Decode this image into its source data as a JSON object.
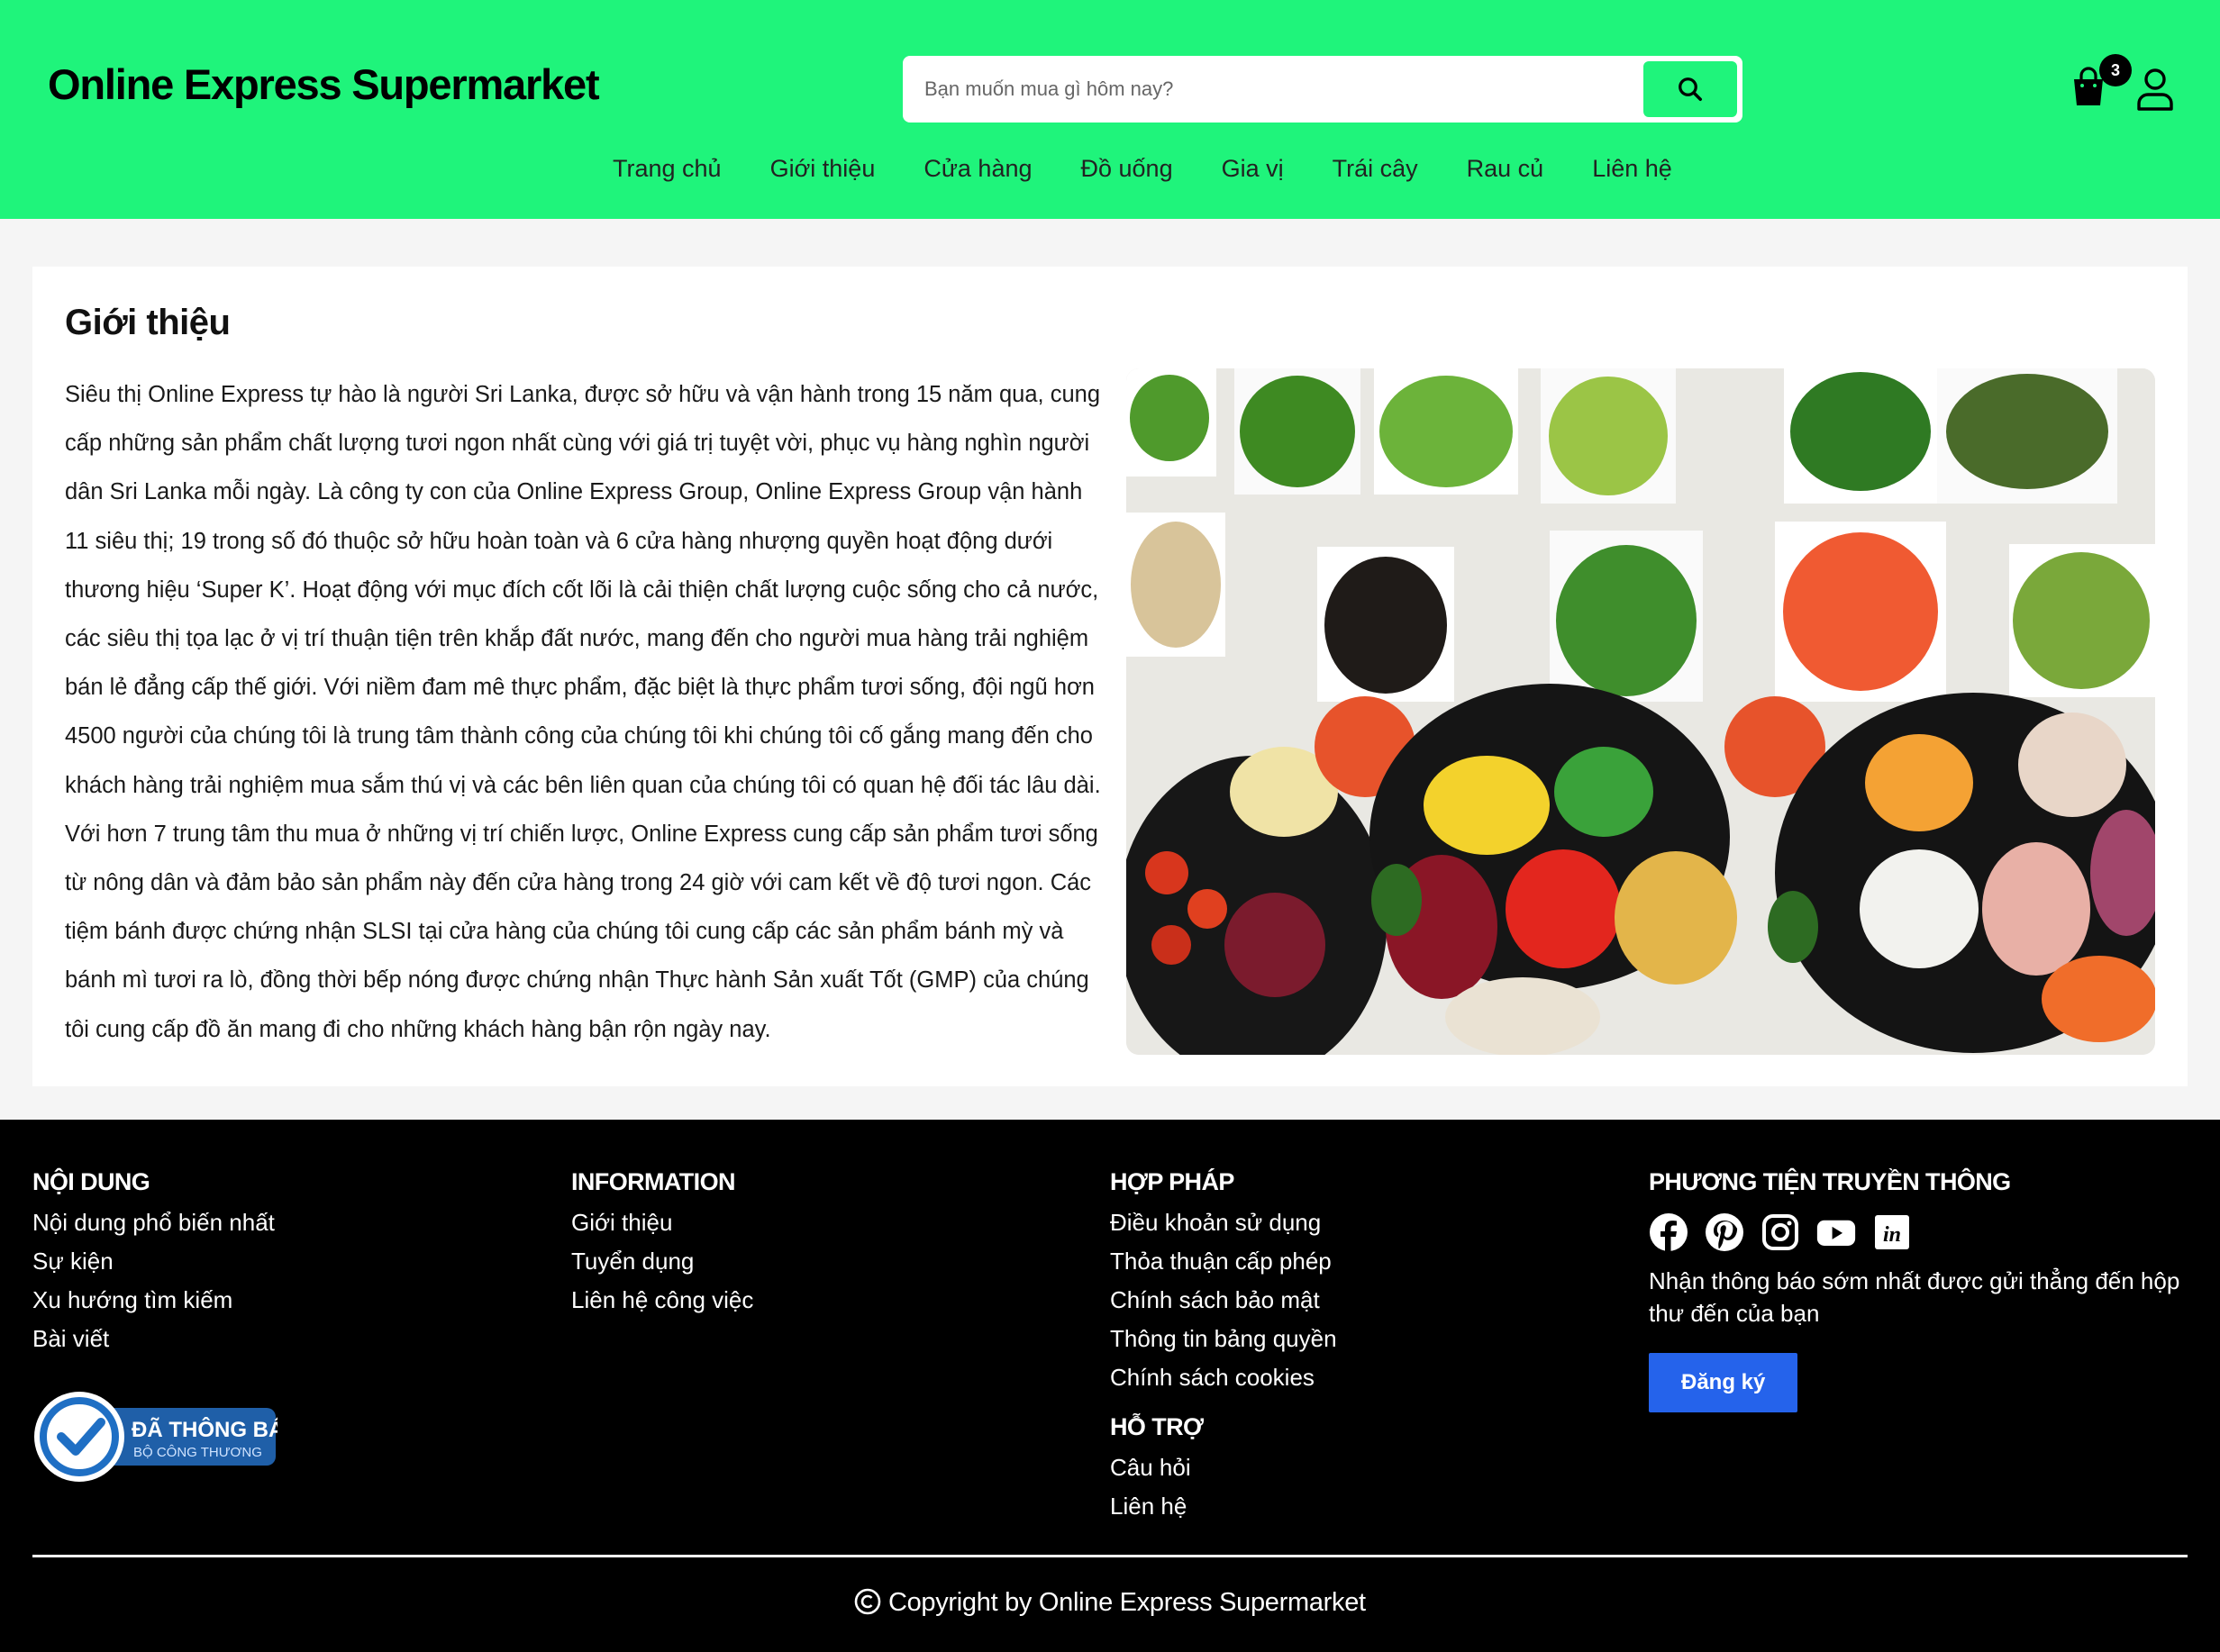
{
  "header": {
    "logo": "Online Express Supermarket",
    "search_placeholder": "Bạn muốn mua gì hôm nay?",
    "cart_count": "3",
    "nav": [
      "Trang chủ",
      "Giới thiệu",
      "Cửa hàng",
      "Đồ uống",
      "Gia vị",
      "Trái cây",
      "Rau củ",
      "Liên hệ"
    ]
  },
  "main": {
    "title": "Giới thiệu",
    "paragraph": "Siêu thị Online Express tự hào là người Sri Lanka, được sở hữu và vận hành trong 15 năm qua, cung cấp những sản phẩm chất lượng tươi ngon nhất cùng với giá trị tuyệt vời, phục vụ hàng nghìn người dân Sri Lanka mỗi ngày. Là công ty con của Online Express Group, Online Express Group vận hành 11 siêu thị; 19 trong số đó thuộc sở hữu hoàn toàn và 6 cửa hàng nhượng quyền hoạt động dưới thương hiệu ‘Super K’. Hoạt động với mục đích cốt lõi là cải thiện chất lượng cuộc sống cho cả nước, các siêu thị tọa lạc ở vị trí thuận tiện trên khắp đất nước, mang đến cho người mua hàng trải nghiệm bán lẻ đẳng cấp thế giới. Với niềm đam mê thực phẩm, đặc biệt là thực phẩm tươi sống, đội ngũ hơn 4500 người của chúng tôi là trung tâm thành công của chúng tôi khi chúng tôi cố gắng mang đến cho khách hàng trải nghiệm mua sắm thú vị và các bên liên quan của chúng tôi có quan hệ đối tác lâu dài. Với hơn 7 trung tâm thu mua ở những vị trí chiến lược, Online Express cung cấp sản phẩm tươi sống từ nông dân và đảm bảo sản phẩm này đến cửa hàng trong 24 giờ với cam kết về độ tươi ngon. Các tiệm bánh được chứng nhận SLSI tại cửa hàng của chúng tôi cung cấp các sản phẩm bánh mỳ và bánh mì tươi ra lò, đồng thời bếp nóng được chứng nhận Thực hành Sản xuất Tốt (GMP) của chúng tôi cung cấp đồ ăn mang đi cho những khách hàng bận rộn ngày nay."
  },
  "footer": {
    "content": {
      "title": "NỘI DUNG",
      "links": [
        "Nội dung phổ biến nhất",
        "Sự kiện",
        "Xu hướng tìm kiếm",
        "Bài viết"
      ]
    },
    "information": {
      "title": "INFORMATION",
      "links": [
        "Giới thiệu",
        "Tuyển dụng",
        "Liên hệ công việc"
      ]
    },
    "legal": {
      "title": "HỢP PHÁP",
      "links": [
        "Điều khoản sử dụng",
        "Thỏa thuận cấp phép",
        "Chính sách bảo mật",
        "Thông tin bảng quyền",
        "Chính sách cookies"
      ]
    },
    "support": {
      "title": "HỖ TRỢ",
      "links": [
        "Câu hỏi",
        "Liên hệ"
      ]
    },
    "media": {
      "title": "PHƯƠNG TIỆN TRUYỀN THÔNG",
      "icons": [
        "facebook-icon",
        "pinterest-icon",
        "instagram-icon",
        "youtube-icon",
        "linkedin-icon"
      ],
      "newsletter": "Nhận thông báo sớm nhất được gửi thẳng đến hộp thư đến của bạn",
      "subscribe": "Đăng ký"
    },
    "gov_badge": {
      "line1": "ĐÃ THÔNG BÁO",
      "line2": "BỘ CÔNG THƯƠNG"
    },
    "copyright": "Copyright by Online Express Supermarket"
  },
  "colors": {
    "brand": "#1ff47b",
    "footer": "#000000",
    "subscribe": "#2563eb"
  }
}
